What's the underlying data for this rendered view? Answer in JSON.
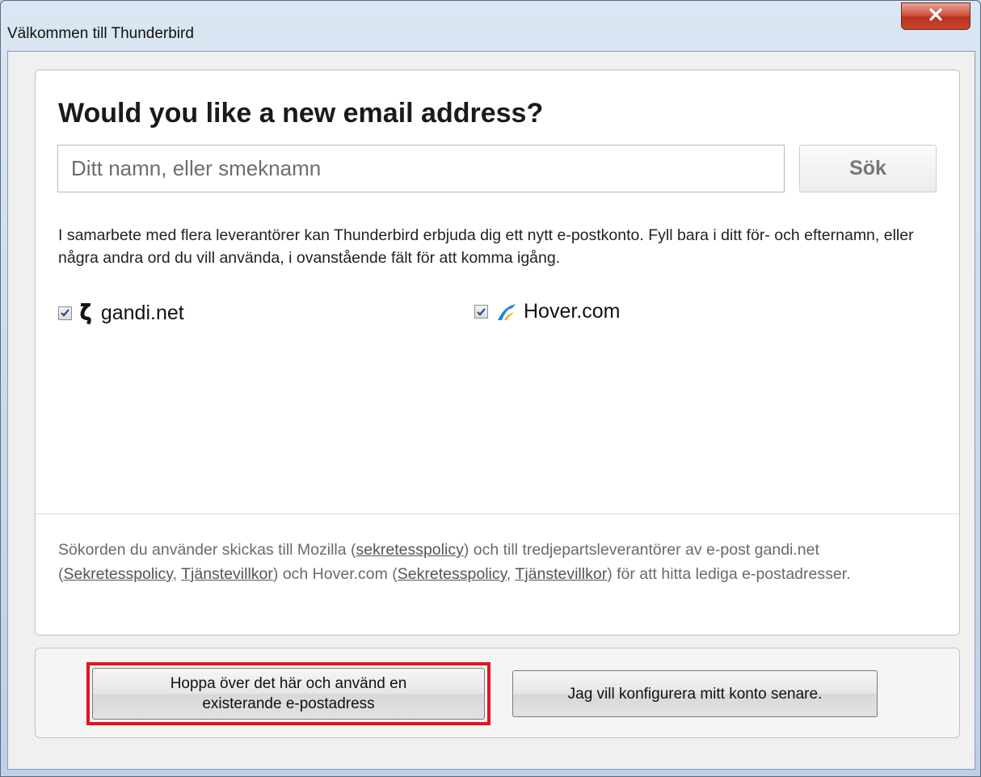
{
  "window": {
    "title": "Välkommen till Thunderbird"
  },
  "main": {
    "heading": "Would you like a new email address?",
    "search_placeholder": "Ditt namn, eller smeknamn",
    "search_button": "Sök",
    "description": "I samarbete med flera leverantörer kan Thunderbird erbjuda dig ett nytt e-postkonto. Fyll bara i ditt för- och efternamn, eller några andra ord du vill använda, i ovanstående fält för att komma igång.",
    "providers": [
      {
        "name": "gandi.net",
        "checked": true,
        "icon": "gandi-logo-icon"
      },
      {
        "name": "Hover.com",
        "checked": true,
        "icon": "hover-logo-icon"
      }
    ],
    "footer": {
      "p1": "Sökorden du använder skickas till Mozilla (",
      "link_privacy": "sekretesspolicy",
      "p2": ") och till tredjepartsleverantörer av e-post gandi.net (",
      "link_gandi_privacy": "Sekretesspolicy",
      "sep1": ", ",
      "link_gandi_terms": "Tjänstevillkor",
      "p3": ") och Hover.com (",
      "link_hover_privacy": "Sekretesspolicy",
      "sep2": ", ",
      "link_hover_terms": "Tjänstevillkor",
      "p4": ") för att hitta lediga e-postadresser."
    }
  },
  "buttons": {
    "skip_line1": "Hoppa över det här och använd en",
    "skip_line2": "existerande e-postadress",
    "later": "Jag vill konfigurera mitt konto senare."
  },
  "colors": {
    "highlight": "#e3141f",
    "close_button": "#c9452e",
    "hover_logo": "#1e88d8"
  }
}
